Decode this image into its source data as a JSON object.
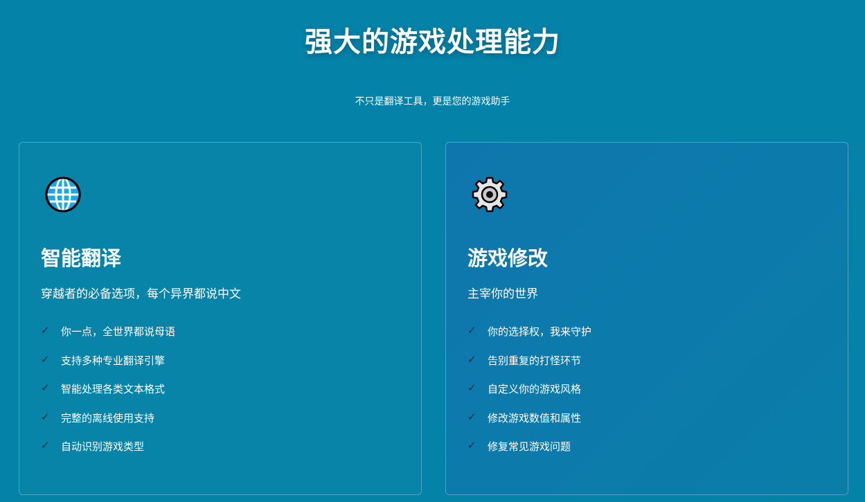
{
  "section": {
    "title": "强大的游戏处理能力",
    "subtitle": "不只是翻译工具，更是您的游戏助手"
  },
  "cards": [
    {
      "icon": "globe-icon",
      "title": "智能翻译",
      "description": "穿越者的必备选项，每个异界都说中文",
      "features": [
        "你一点，全世界都说母语",
        "支持多种专业翻译引擎",
        "智能处理各类文本格式",
        "完整的离线使用支持",
        "自动识别游戏类型"
      ]
    },
    {
      "icon": "gear-icon",
      "title": "游戏修改",
      "description": "主宰你的世界",
      "features": [
        "你的选择权，我来守护",
        "告别重复的打怪环节",
        "自定义你的游戏风格",
        "修改游戏数值和属性",
        "修复常见游戏问题"
      ]
    }
  ],
  "check_symbol": "✓",
  "colors": {
    "background": "#0582a8",
    "card_right_tint": "#0f76ad",
    "checkmark": "#0d2a45",
    "globe_blue": "#1aa7e8"
  }
}
